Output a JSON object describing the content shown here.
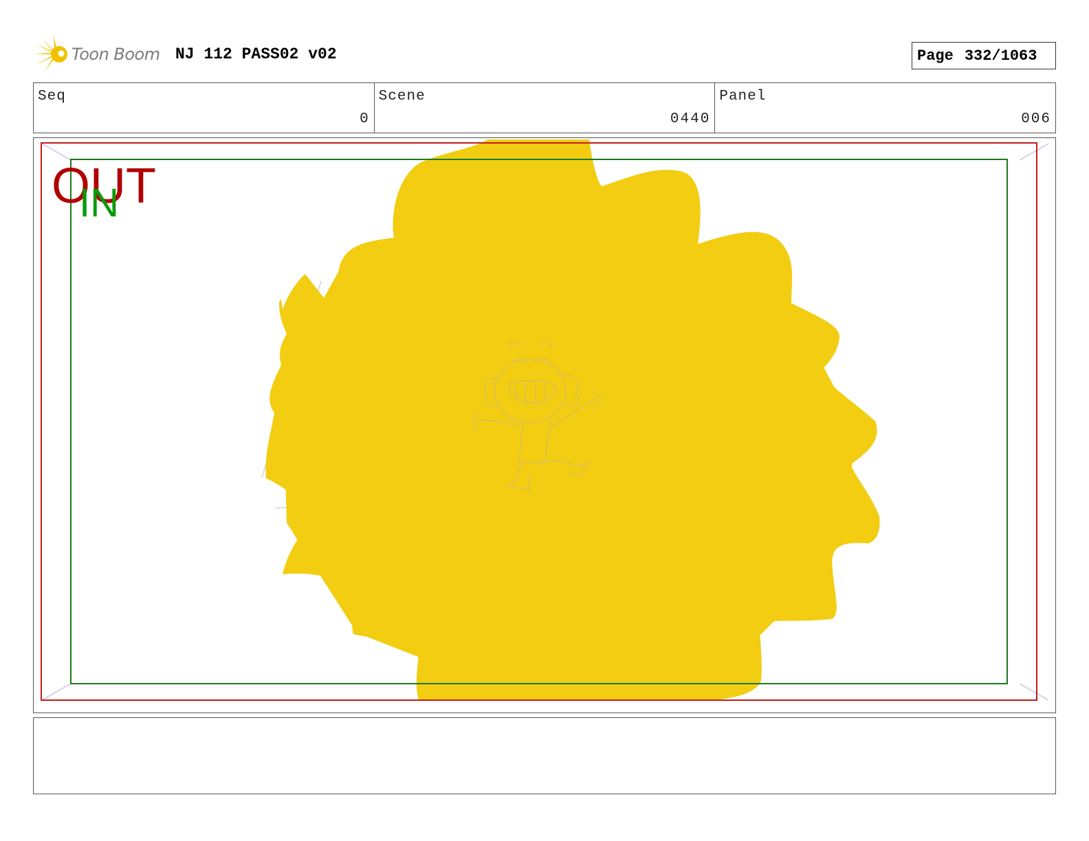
{
  "header": {
    "logo_text": "Toon Boom",
    "title": "NJ 112 PASS02 v02",
    "page_label": "Page",
    "page_value": "332/1063"
  },
  "info": {
    "seq_label": "Seq",
    "seq_value": "0",
    "scene_label": "Scene",
    "scene_value": "0440",
    "panel_label": "Panel",
    "panel_value": "006"
  },
  "frame": {
    "out_label": "OUT",
    "in_label": "IN",
    "out_color": "#b00000",
    "in_color": "#0a9a0a",
    "burst_color": "#f2cd12"
  },
  "notes": {
    "text": ""
  }
}
